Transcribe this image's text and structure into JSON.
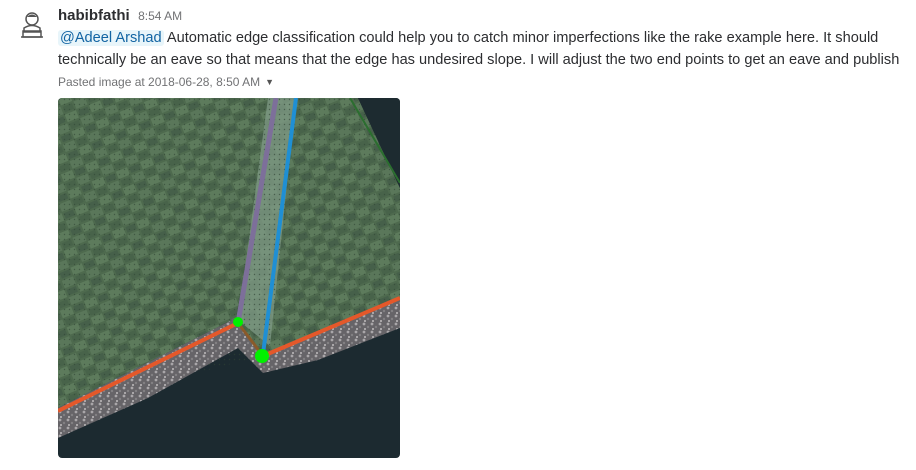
{
  "message": {
    "username": "habibfathi",
    "timestamp": "8:54 AM",
    "mention": "@Adeel Arshad",
    "text": "Automatic edge classification could help you to catch minor imperfections like the rake example here. It should technically be an eave so that means that the edge has undesired slope. I will adjust the two end points to get an eave and publish"
  },
  "attachment": {
    "meta": "Pasted image at 2018-06-28, 8:50 AM",
    "caret_icon": "caret-down-icon",
    "image_icon": "roof-point-cloud-image"
  },
  "colors": {
    "mention_bg": "#e8f5fa",
    "mention_text": "#1264a3",
    "eave_edge": "#e4582a",
    "rake_edge": "#7d6f9a",
    "ridge_edge": "#1f8fd4",
    "endpoint": "#00f000"
  }
}
